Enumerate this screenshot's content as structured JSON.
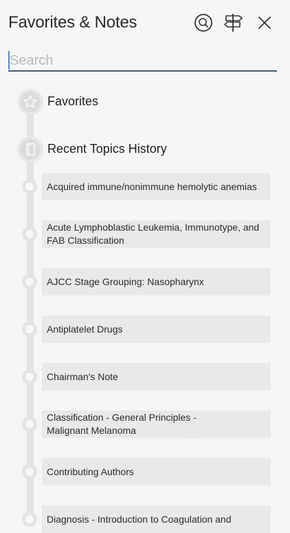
{
  "header": {
    "title": "Favorites & Notes",
    "icons": [
      "search-icon",
      "signpost-icon",
      "close-icon"
    ]
  },
  "search": {
    "placeholder": "Search",
    "value": ""
  },
  "sections": {
    "favorites": {
      "label": "Favorites",
      "icon": "star-icon"
    },
    "recent": {
      "label": "Recent Topics History",
      "icon": "book-icon"
    }
  },
  "recent_topics": [
    "Acquired immune/nonimmune hemolytic anemias",
    "Acute Lymphoblastic Leukemia, Immunotype, and FAB Classification",
    "AJCC Stage Grouping: Nasopharynx",
    "Antiplatelet Drugs",
    "Chairman's Note",
    "Classification - General Principles -\nMalignant Melanoma",
    "Contributing Authors",
    "Diagnosis - Introduction to Coagulation and"
  ],
  "colors": {
    "background": "#f8f8f8",
    "card": "#e9e9e9",
    "timeline": "#e3e3e3",
    "search_underline": "#3f5f72",
    "caret": "#4a8ad8"
  }
}
